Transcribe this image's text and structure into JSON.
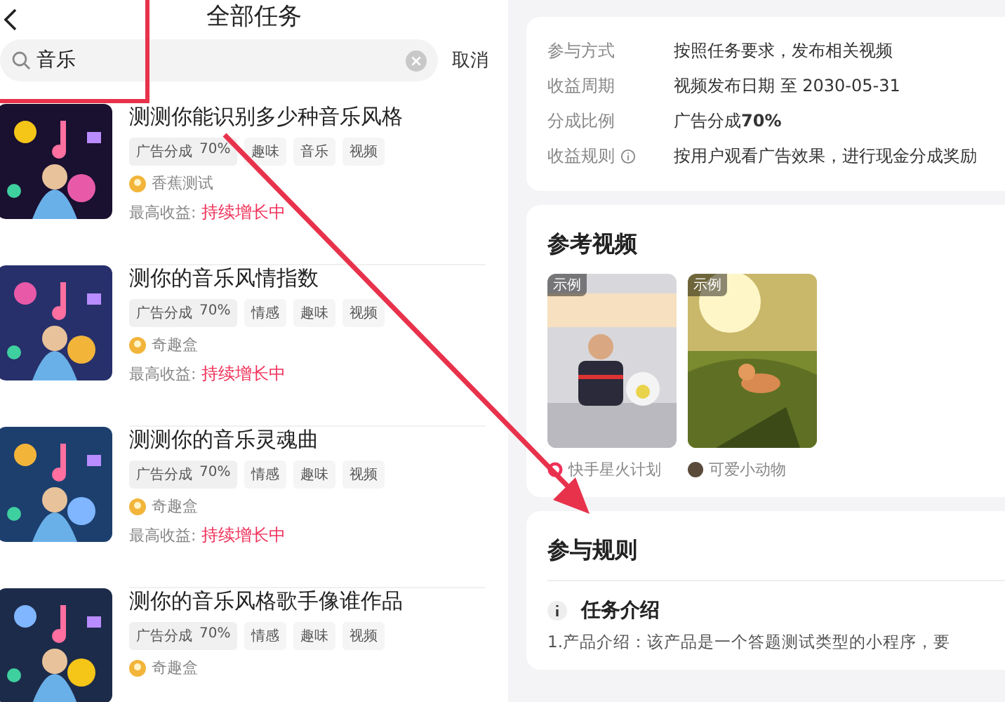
{
  "left": {
    "title": "全部任务",
    "search": {
      "value": "音乐"
    },
    "cancel": "取消",
    "tasks": [
      {
        "title": "测测你能识别多少种音乐风格",
        "share": "广告分成",
        "percent": "70%",
        "tags": [
          "趣味",
          "音乐",
          "视频"
        ],
        "author": "香蕉测试",
        "earnings_label": "最高收益:",
        "earnings": "持续增长中"
      },
      {
        "title": "测你的音乐风情指数",
        "share": "广告分成",
        "percent": "70%",
        "tags": [
          "情感",
          "趣味",
          "视频"
        ],
        "author": "奇趣盒",
        "earnings_label": "最高收益:",
        "earnings": "持续增长中"
      },
      {
        "title": "测测你的音乐灵魂曲",
        "share": "广告分成",
        "percent": "70%",
        "tags": [
          "情感",
          "趣味",
          "视频"
        ],
        "author": "奇趣盒",
        "earnings_label": "最高收益:",
        "earnings": "持续增长中"
      },
      {
        "title": "测你的音乐风格歌手像谁作品",
        "share": "广告分成",
        "percent": "70%",
        "tags": [
          "情感",
          "趣味",
          "视频"
        ],
        "author": "奇趣盒"
      }
    ]
  },
  "right": {
    "info": [
      {
        "label": "参与方式",
        "value": "按照任务要求，发布相关视频",
        "info_icon": false
      },
      {
        "label": "收益周期",
        "value": "视频发布日期  至  2030-05-31",
        "info_icon": false
      },
      {
        "label": "分成比例",
        "value": "广告分成**70%**",
        "info_icon": false
      },
      {
        "label": "收益规则",
        "value": "按用户观看广告效果，进行现金分成奖励",
        "info_icon": true
      }
    ],
    "videos_title": "参考视频",
    "videos": [
      {
        "badge": "示例",
        "author": "快手星火计划"
      },
      {
        "badge": "示例",
        "author": "可爱小动物"
      }
    ],
    "rules_title": "参与规则",
    "intro_title": "任务介绍",
    "intro_text": "1.产品介绍：该产品是一个答题测试类型的小程序，要"
  }
}
